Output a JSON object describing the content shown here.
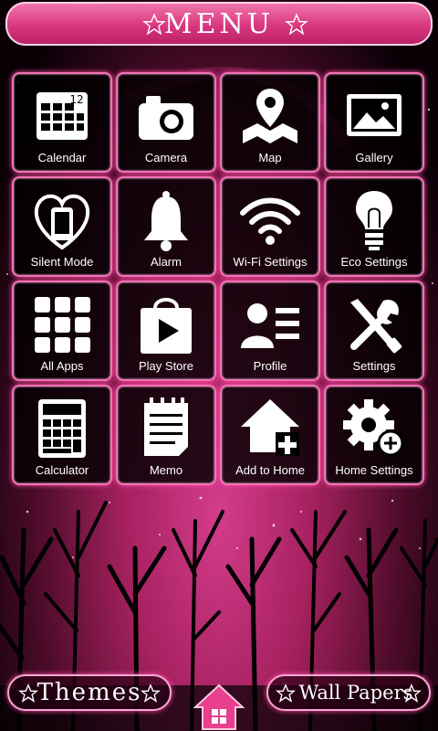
{
  "header": {
    "title": "MENU"
  },
  "tiles": [
    {
      "label": "Calendar",
      "icon": "calendar-icon",
      "badge": "12"
    },
    {
      "label": "Camera",
      "icon": "camera-icon"
    },
    {
      "label": "Map",
      "icon": "map-icon"
    },
    {
      "label": "Gallery",
      "icon": "gallery-icon"
    },
    {
      "label": "Silent Mode",
      "icon": "silent-mode-icon"
    },
    {
      "label": "Alarm",
      "icon": "bell-icon"
    },
    {
      "label": "Wi-Fi Settings",
      "icon": "wifi-icon"
    },
    {
      "label": "Eco Settings",
      "icon": "lightbulb-icon"
    },
    {
      "label": "All Apps",
      "icon": "all-apps-icon"
    },
    {
      "label": "Play Store",
      "icon": "play-store-icon"
    },
    {
      "label": "Profile",
      "icon": "profile-icon"
    },
    {
      "label": "Settings",
      "icon": "tools-icon"
    },
    {
      "label": "Calculator",
      "icon": "calculator-icon"
    },
    {
      "label": "Memo",
      "icon": "memo-icon"
    },
    {
      "label": "Add to Home",
      "icon": "add-home-icon"
    },
    {
      "label": "Home Settings",
      "icon": "gear-icon"
    }
  ],
  "bottom": {
    "themes_label": "Themes",
    "wallpapers_label": "Wall Papers"
  },
  "colors": {
    "accent": "#f472b6",
    "header": "#d8377f",
    "background": "#000000"
  }
}
